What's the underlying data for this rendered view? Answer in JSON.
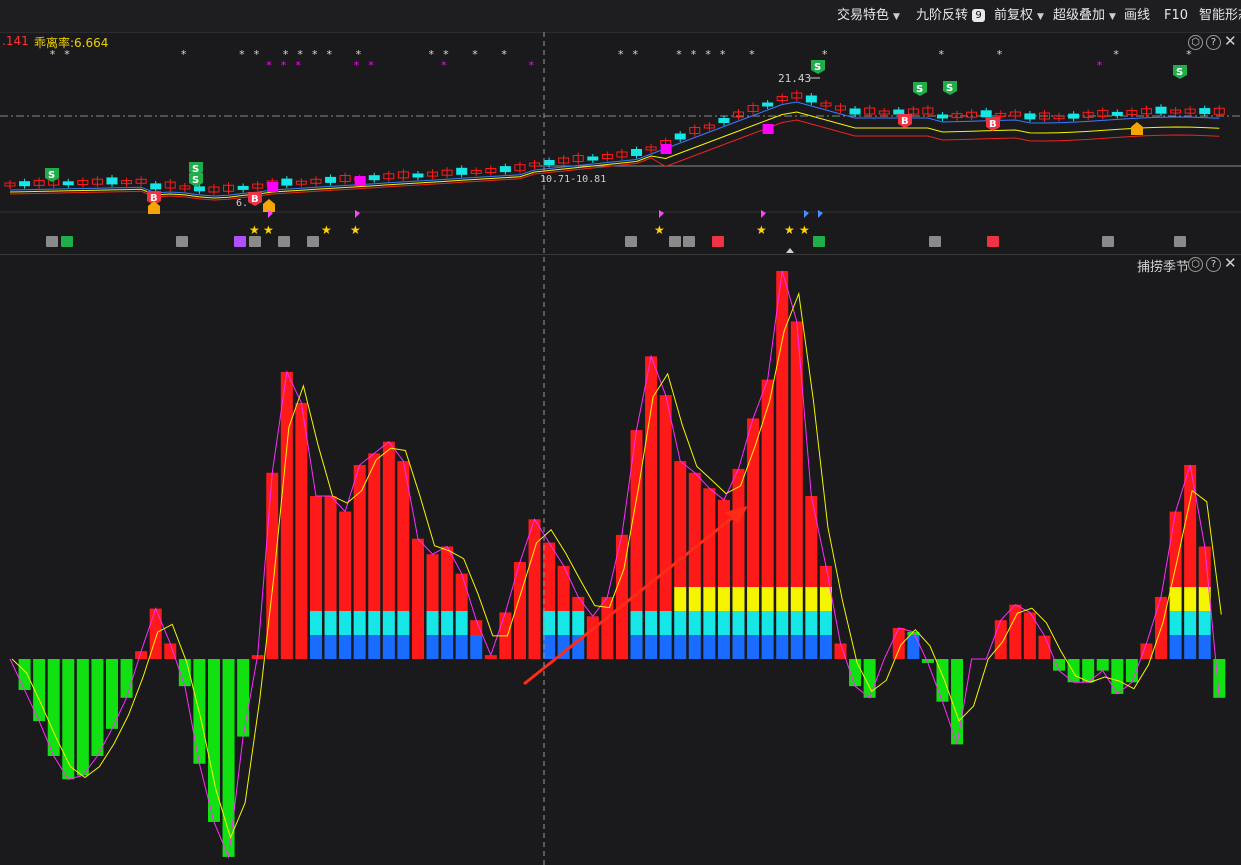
{
  "toolbar": {
    "items": [
      {
        "label": "交易特色",
        "caret": "▼"
      },
      {
        "label": "九阶反转",
        "badge": "9"
      },
      {
        "label": "前复权",
        "caret": "▼"
      },
      {
        "label": "超级叠加",
        "caret": "▼"
      },
      {
        "label": "画线"
      },
      {
        "label": "F10"
      },
      {
        "label": "智能形态"
      }
    ]
  },
  "top_panel": {
    "header_left_value": ".141",
    "indicator_label": "乖离率:6.664",
    "high_price_label": "21.43",
    "cursor_price_label": "10.71-10.81",
    "cut_label": "6."
  },
  "bottom_panel": {
    "title": "捕捞季节"
  },
  "controls": {
    "settings": "⬡",
    "help": "?",
    "close": "✕"
  },
  "colors": {
    "up": "#ff1a1a",
    "down": "#11e011",
    "cyan": "#16e6e6",
    "blue": "#1a6bff",
    "yellow": "#f5f500",
    "magenta": "#ff00ff",
    "buy_badge": "#ee3344",
    "sell_badge": "#1fae4a"
  },
  "chart_data": {
    "type": "bar",
    "histogram_values": [
      0.0,
      -0.8,
      -1.6,
      -2.5,
      -3.1,
      -3.0,
      -2.5,
      -1.8,
      -1.0,
      0.2,
      1.3,
      0.4,
      -0.7,
      -2.7,
      -4.2,
      -5.1,
      -2.0,
      0.1,
      4.8,
      7.4,
      6.6,
      4.2,
      4.2,
      3.8,
      5.0,
      5.3,
      5.6,
      5.1,
      3.1,
      2.7,
      2.9,
      2.2,
      1.0,
      0.1,
      1.2,
      2.5,
      3.6,
      3.0,
      2.4,
      1.6,
      1.1,
      1.6,
      3.2,
      5.9,
      7.8,
      6.8,
      5.1,
      4.8,
      4.4,
      4.1,
      4.9,
      6.2,
      7.2,
      10.0,
      8.7,
      4.2,
      2.4,
      0.4,
      -0.7,
      -1.0,
      0.0,
      0.8,
      0.7,
      -0.1,
      -1.1,
      -2.2,
      0.0,
      0.0,
      1.0,
      1.4,
      1.2,
      0.6,
      -0.3,
      -0.6,
      -0.6,
      -0.3,
      -0.9,
      -0.6,
      0.4,
      1.6,
      3.8,
      5.0,
      2.9,
      -1.0
    ],
    "color_bands": [
      "blue",
      "cyan",
      "yellow"
    ]
  }
}
